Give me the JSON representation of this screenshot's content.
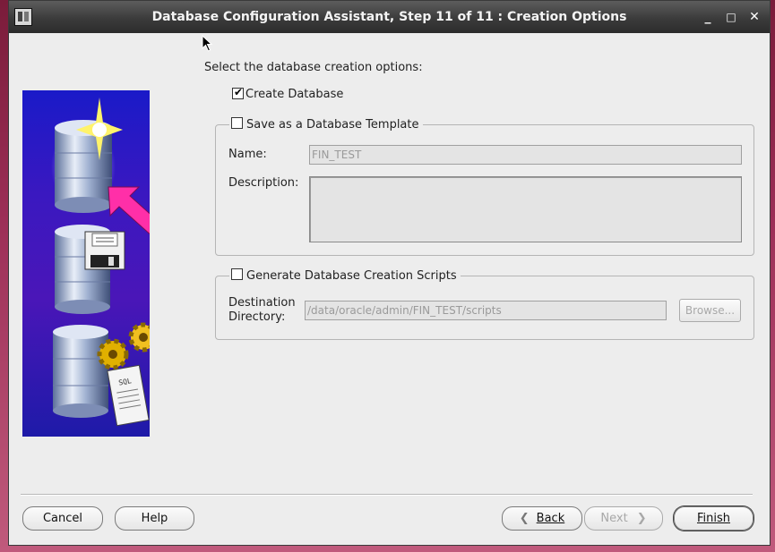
{
  "window": {
    "title": "Database Configuration Assistant, Step 11 of 11 : Creation Options",
    "minimize_symbol": "_",
    "maximize_symbol": "□",
    "close_symbol": "✕"
  },
  "main": {
    "prompt": "Select the database creation options:",
    "create_database": {
      "label": "Create Database",
      "checked": true
    },
    "template": {
      "label": "Save as a Database Template",
      "checked": false,
      "name_label": "Name:",
      "name_value": "FIN_TEST",
      "description_label": "Description:",
      "description_value": ""
    },
    "scripts": {
      "label": "Generate Database Creation Scripts",
      "checked": false,
      "dest_label_line1": "Destination",
      "dest_label_line2": "Directory:",
      "dest_value": "/data/oracle/admin/FIN_TEST/scripts",
      "browse_label": "Browse..."
    }
  },
  "footer": {
    "cancel_label": "Cancel",
    "help_label": "Help",
    "back_label": "Back",
    "next_label": "Next",
    "finish_label": "Finish"
  },
  "illustration": {
    "sql_label": "SQL"
  },
  "icons": [
    "app-icon",
    "database-cylinder-icon",
    "sparkle-icon",
    "arrow-icon",
    "floppy-disk-icon",
    "gear-icon",
    "sql-scroll-icon",
    "mouse-cursor-icon",
    "chevron-left-icon",
    "chevron-right-icon"
  ]
}
